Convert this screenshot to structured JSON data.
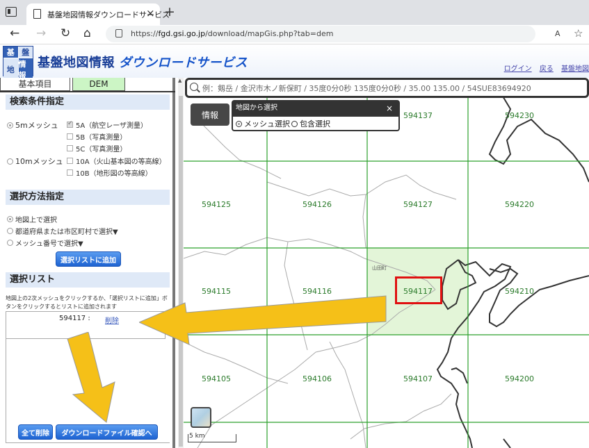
{
  "browser": {
    "tab_title": "基盤地図情報ダウンロードサービス",
    "url_prefix": "https://",
    "url_host": "fgd.gsi.go.jp",
    "url_path": "/download/mapGis.php?tab=dem",
    "read_aloud": "A",
    "new_tab": "+",
    "tab_close": "×"
  },
  "header": {
    "logo": [
      "基",
      "盤",
      "地",
      "情報"
    ],
    "title": "基盤地図情報",
    "title_service": "ダウンロードサービス",
    "links": [
      "ログイン",
      "戻る",
      "基盤地図"
    ]
  },
  "left_panel": {
    "tabs": [
      "基本項目",
      "DEM"
    ],
    "search_section": "検索条件指定",
    "mesh5m_label": "5mメッシュ",
    "mesh10m_label": "10mメッシュ",
    "options_5m": [
      "5A（航空レーザ測量）",
      "5B（写真測量）",
      "5C（写真測量）"
    ],
    "options_10m": [
      "10A（火山基本図の等高線）",
      "10B（地形図の等高線）"
    ],
    "method_section": "選択方法指定",
    "methods": [
      "地図上で選択",
      "都道府県または市区町村で選択▼",
      "メッシュ番号で選択▼"
    ],
    "add_button": "選択リストに追加",
    "list_section": "選択リスト",
    "list_note": "地図上の2次メッシュをクリックするか、「選択リストに追加」ボタンをクリックするとリストに追加されます",
    "list_items": [
      {
        "code": "594117 :",
        "delete": "削除"
      }
    ],
    "delete_all_button": "全て削除",
    "download_button": "ダウンロードファイル確認へ"
  },
  "map": {
    "search_placeholder": "例：剱岳 / 金沢市木ノ新保町 / 35度0分0秒 135度0分0秒 / 35.00 135.00 / 54SUE83694920",
    "info_button": "情報",
    "popup_title": "地図から選択",
    "popup_close": "×",
    "popup_options": [
      "メッシュ選択",
      "包含選択"
    ],
    "place_label": "山田町",
    "scale_label": "5 km",
    "mesh_labels": [
      "594137",
      "594230",
      "594125",
      "594126",
      "594127",
      "594220",
      "594115",
      "594116",
      "594117",
      "594210",
      "594105",
      "594106",
      "594107",
      "594200"
    ],
    "selected_mesh": "594117"
  },
  "colors": {
    "grid_line": "#2ca02c",
    "selected_fill": "#e3f5d8",
    "highlight": "#e01010",
    "arrow": "#f5c018"
  }
}
